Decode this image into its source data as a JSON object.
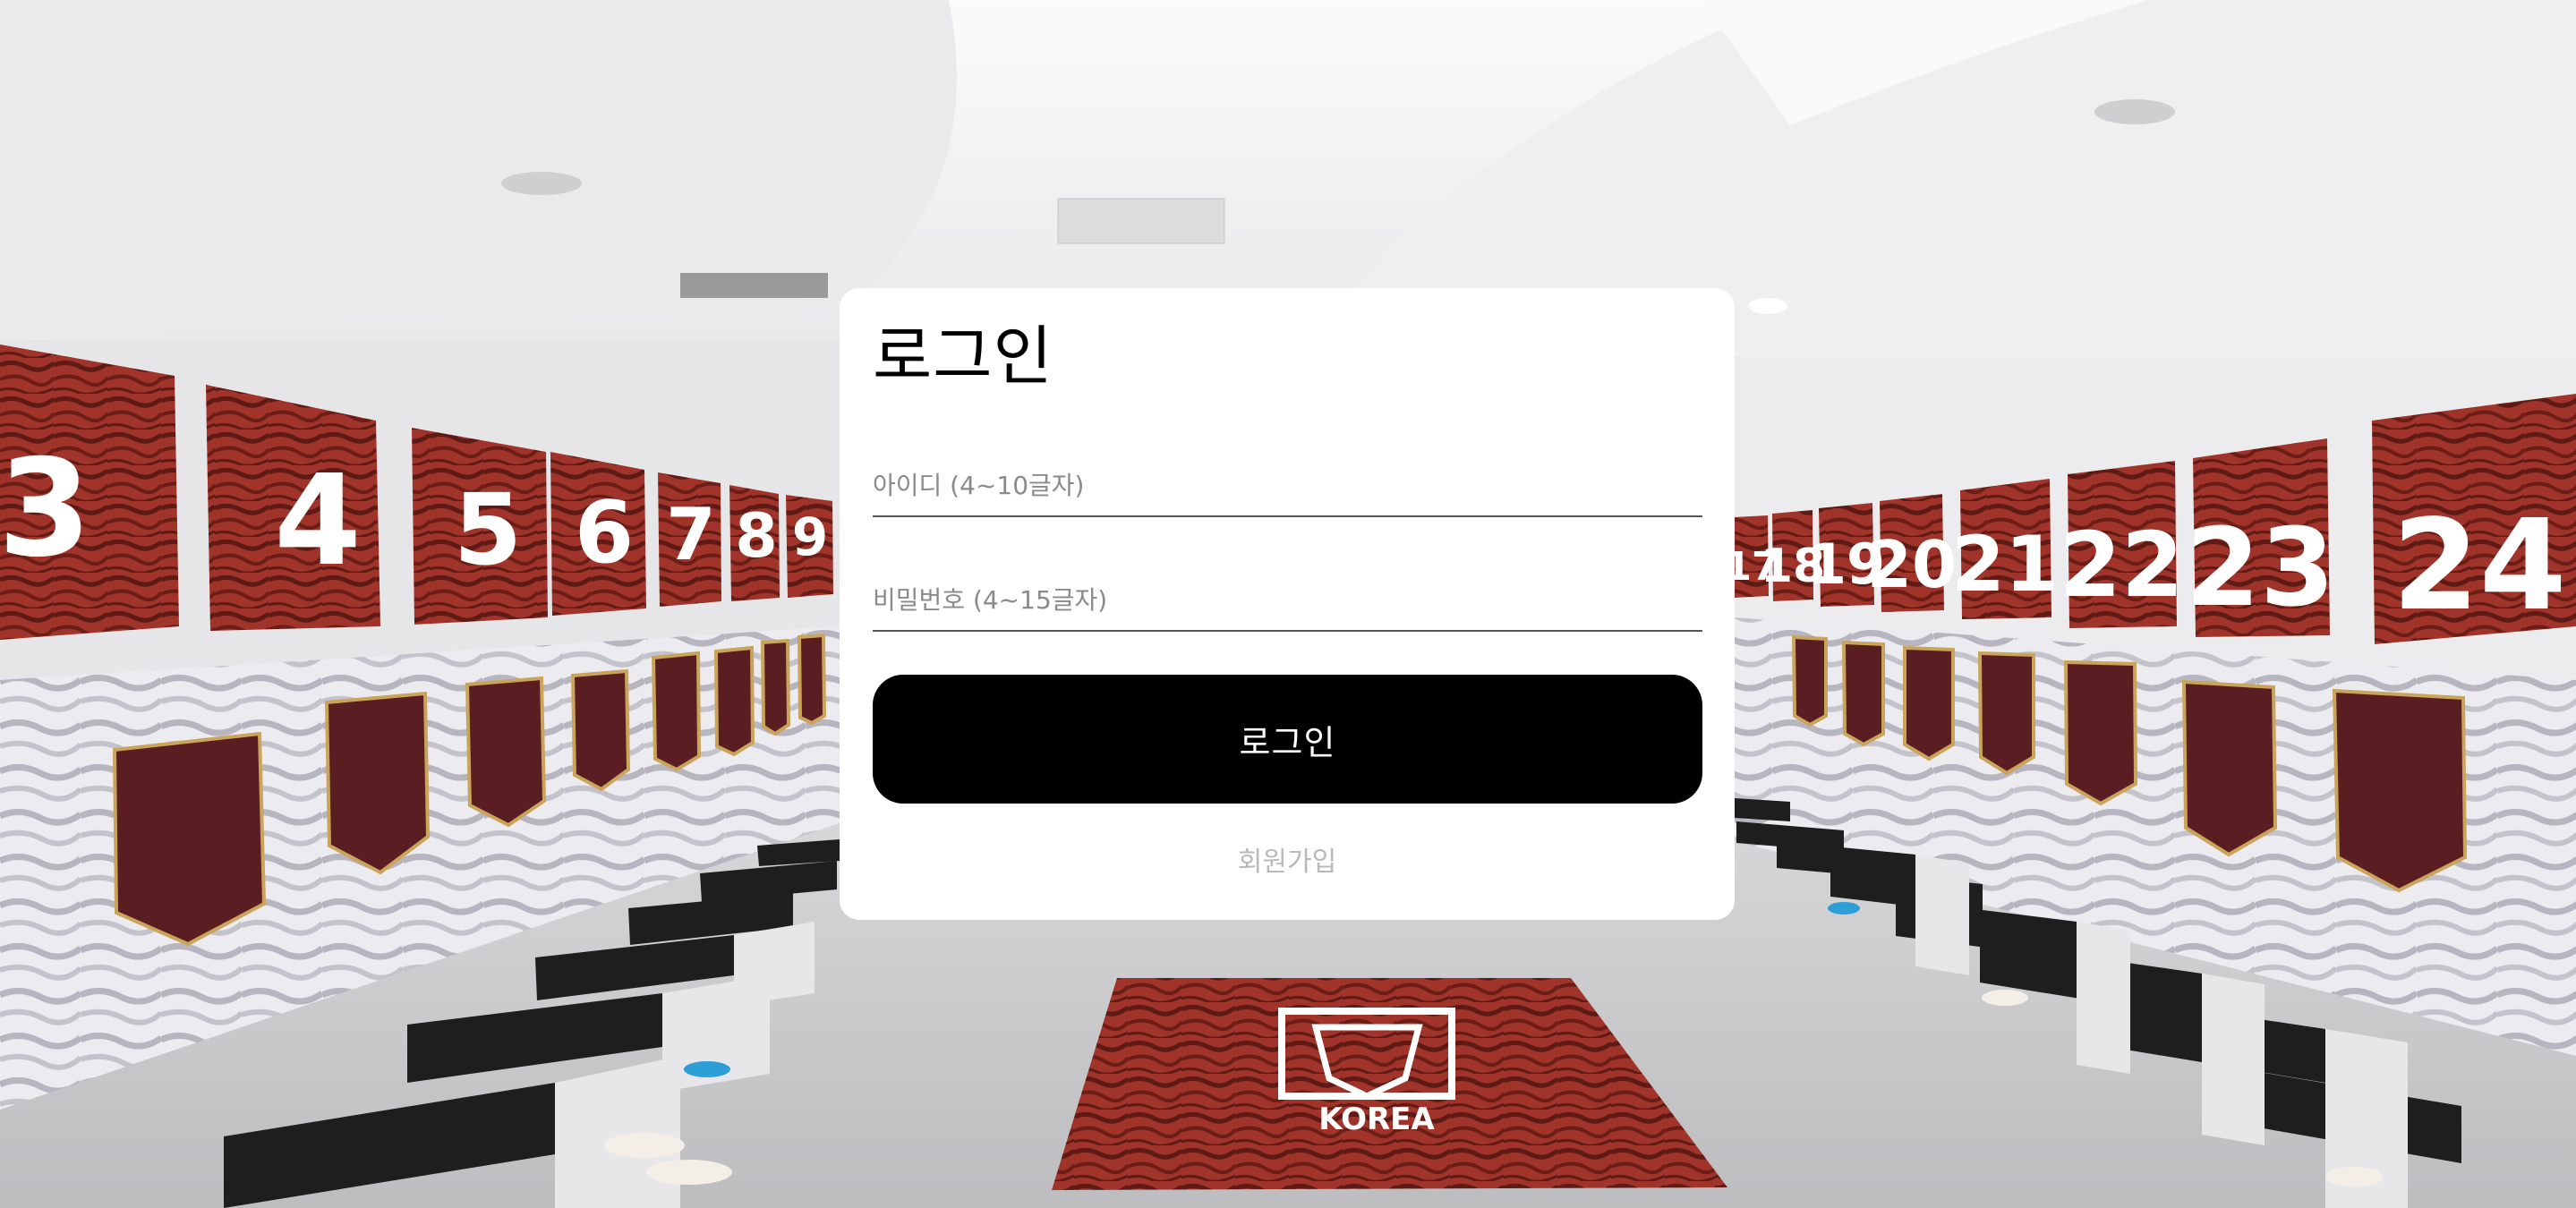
{
  "login_form": {
    "title": "로그인",
    "username_placeholder": "아이디 (4~10글자)",
    "password_placeholder": "비밀번호 (4~15글자)",
    "login_button_label": "로그인",
    "signup_link_label": "회원가입"
  },
  "background": {
    "locker_numbers_left": [
      "3",
      "4",
      "5",
      "6",
      "7",
      "8",
      "9"
    ],
    "locker_numbers_right": [
      "17",
      "18",
      "19",
      "20",
      "21",
      "22",
      "23",
      "24"
    ],
    "floor_logo_text": "KOREA",
    "colors": {
      "jersey_red": "#8e2a22",
      "bench_black": "#1e1e1e",
      "wall": "#e9e9ea",
      "ceiling": "#f2f2f3",
      "floor": "#cfcfd1"
    }
  }
}
